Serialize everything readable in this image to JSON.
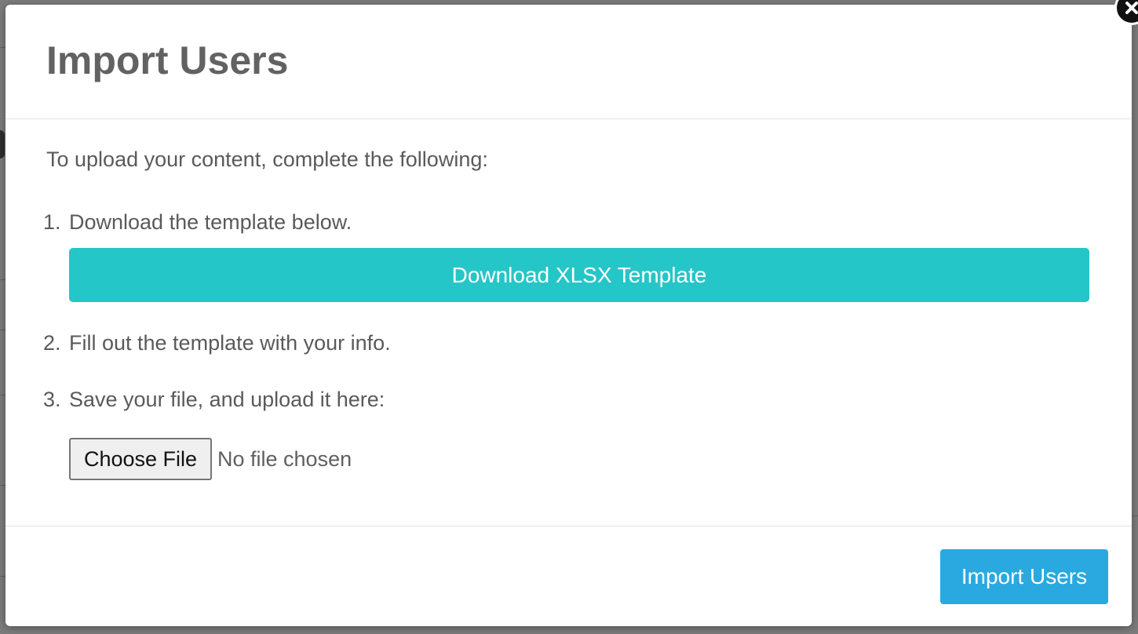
{
  "modal": {
    "title": "Import Users",
    "intro": "To upload your content, complete the following:",
    "steps": [
      {
        "number": "1.",
        "text": "Download the template below."
      },
      {
        "number": "2.",
        "text": "Fill out the template with your info."
      },
      {
        "number": "3.",
        "text": "Save your file, and upload it here:"
      }
    ],
    "download_button_label": "Download XLSX Template",
    "file_input": {
      "button_label": "Choose File",
      "status": "No file chosen"
    },
    "import_button_label": "Import Users",
    "close_icon": "close-icon"
  },
  "colors": {
    "download_button": "#25c6c8",
    "import_button": "#29a9e0",
    "title_text": "#626262",
    "body_text": "#5a5a5a"
  }
}
